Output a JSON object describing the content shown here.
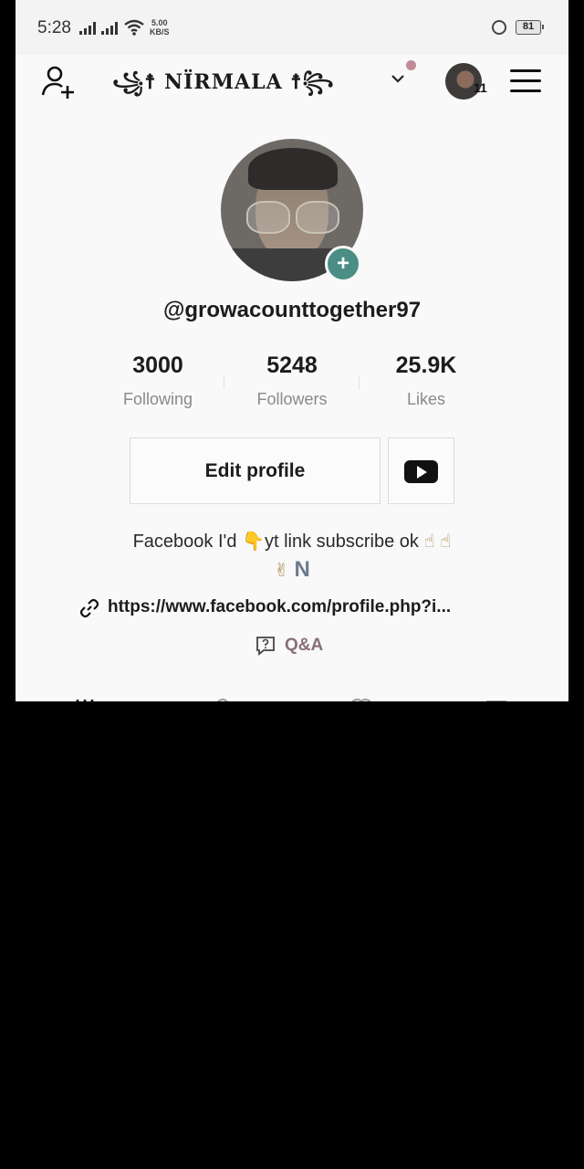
{
  "status_bar": {
    "time": "5:28",
    "net_speed_value": "5.00",
    "net_speed_unit": "KB/S",
    "battery": "81"
  },
  "top_bar": {
    "title": "꧁☨ NÏRMALA ☨꧂",
    "notification_count": "11"
  },
  "profile": {
    "username": "@growacounttogether97",
    "stats": [
      {
        "value": "3000",
        "label": "Following"
      },
      {
        "value": "5248",
        "label": "Followers"
      },
      {
        "value": "25.9K",
        "label": "Likes"
      }
    ],
    "edit_profile_label": "Edit profile",
    "bio_line1_a": "Facebook I'd ",
    "bio_line1_b": "yt   link subscribe ok",
    "bio_line2_letter": "N",
    "link": "https://www.facebook.com/profile.php?i...",
    "qa_label": "Q&A"
  },
  "colors": {
    "accent_teal": "#4a8e86",
    "notification_dot": "#c08a96",
    "qa_text": "#8a6f76"
  },
  "icons": [
    "add-user-icon",
    "chevron-down-icon",
    "menu-icon",
    "plus-icon",
    "youtube-icon",
    "link-icon",
    "qa-icon"
  ]
}
